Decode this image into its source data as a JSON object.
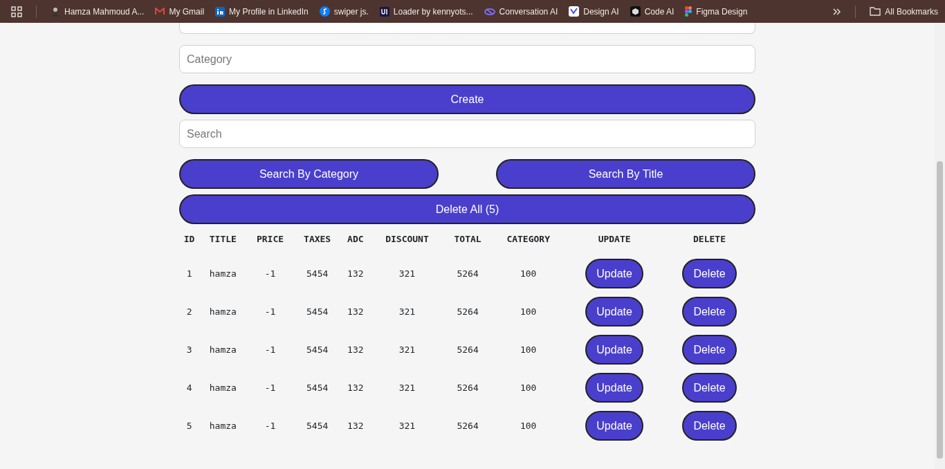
{
  "bookmarks": [
    {
      "label": "Hamza Mahmoud A..."
    },
    {
      "label": "My Gmail"
    },
    {
      "label": "My Profile in LinkedIn"
    },
    {
      "label": "swiper js."
    },
    {
      "label": "Loader by kennyots..."
    },
    {
      "label": "Conversation AI"
    },
    {
      "label": "Design AI"
    },
    {
      "label": "Code AI"
    },
    {
      "label": "Figma Design"
    }
  ],
  "all_bookmarks": "All Bookmarks",
  "form": {
    "category_placeholder": "Category",
    "create": "Create",
    "search_placeholder": "Search",
    "search_by_category": "Search By Category",
    "search_by_title": "Search By Title",
    "delete_all": "Delete All (5)"
  },
  "table": {
    "columns": [
      "ID",
      "TITLE",
      "PRICE",
      "TAXES",
      "ADC",
      "DISCOUNT",
      "TOTAL",
      "CATEGORY",
      "UPDATE",
      "DELETE"
    ],
    "rows": [
      {
        "cells": [
          "1",
          "hamza",
          "-1",
          "5454",
          "132",
          "321",
          "5264",
          "100"
        ],
        "update": "Update",
        "delete": "Delete"
      },
      {
        "cells": [
          "2",
          "hamza",
          "-1",
          "5454",
          "132",
          "321",
          "5264",
          "100"
        ],
        "update": "Update",
        "delete": "Delete"
      },
      {
        "cells": [
          "3",
          "hamza",
          "-1",
          "5454",
          "132",
          "321",
          "5264",
          "100"
        ],
        "update": "Update",
        "delete": "Delete"
      },
      {
        "cells": [
          "4",
          "hamza",
          "-1",
          "5454",
          "132",
          "321",
          "5264",
          "100"
        ],
        "update": "Update",
        "delete": "Delete"
      },
      {
        "cells": [
          "5",
          "hamza",
          "-1",
          "5454",
          "132",
          "321",
          "5264",
          "100"
        ],
        "update": "Update",
        "delete": "Delete"
      }
    ]
  }
}
